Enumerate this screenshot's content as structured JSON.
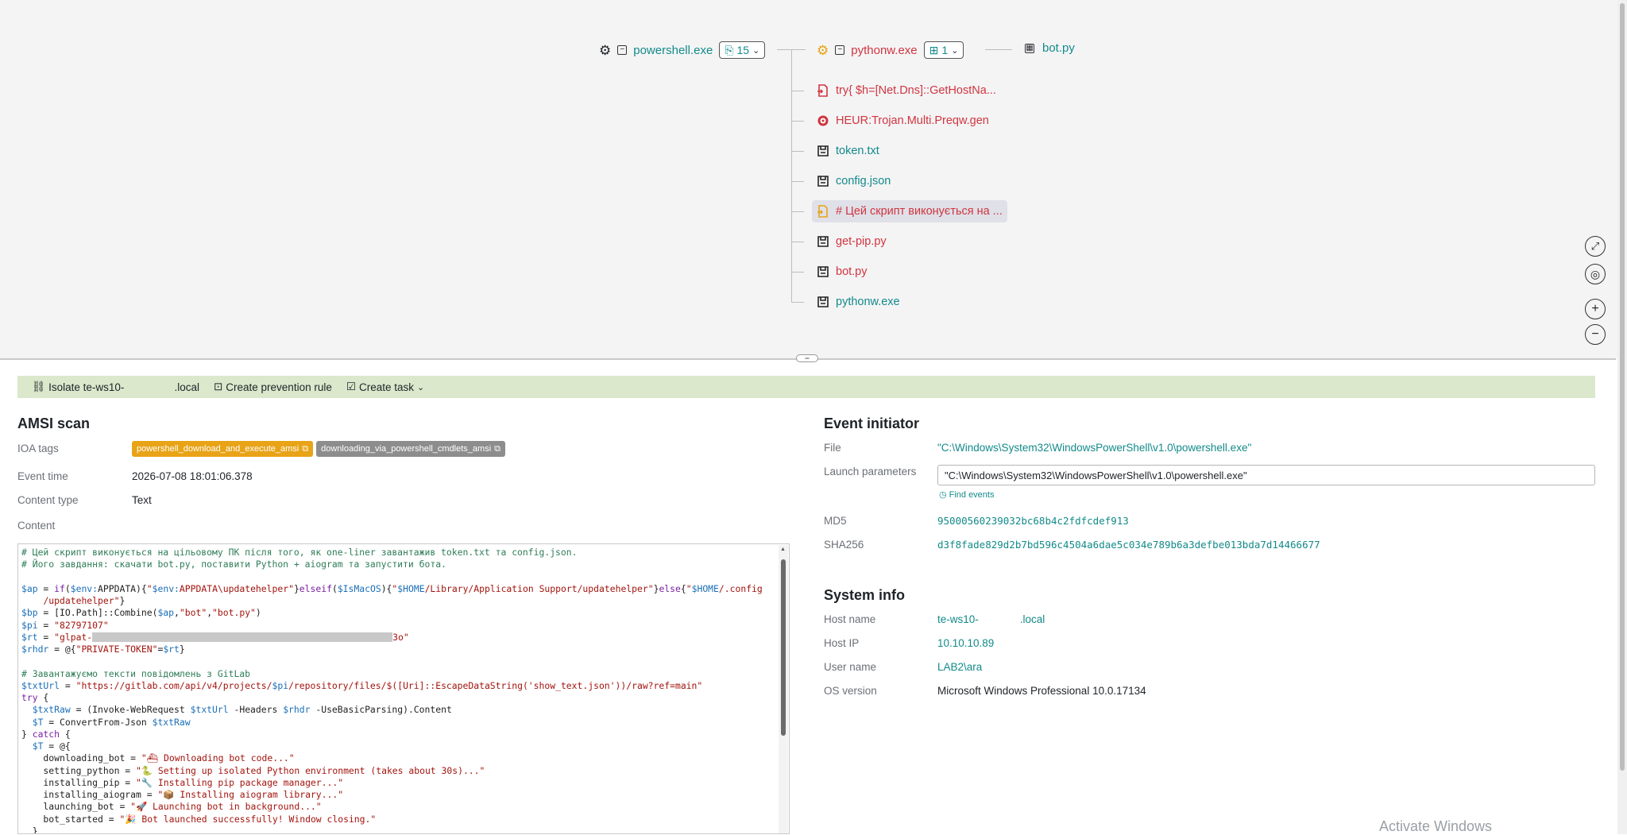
{
  "graph": {
    "root": {
      "label": "powershell.exe",
      "count": "15"
    },
    "child": {
      "label": "pythonw.exe",
      "count": "1"
    },
    "leaf": {
      "label": "bot.py"
    },
    "events": [
      {
        "label": "try{ $h=[Net.Dns]::GetHostNa...",
        "color": "red",
        "icon": "script-exec-icon"
      },
      {
        "label": "HEUR:Trojan.Multi.Preqw.gen",
        "color": "red",
        "icon": "detection-icon"
      },
      {
        "label": "token.txt",
        "color": "teal",
        "icon": "file-write-icon"
      },
      {
        "label": "config.json",
        "color": "teal",
        "icon": "file-write-icon"
      },
      {
        "label": "# Цей скрипт виконується на ...",
        "color": "red",
        "icon": "script-exec-icon"
      },
      {
        "label": "get-pip.py",
        "color": "red",
        "icon": "file-write-icon"
      },
      {
        "label": "bot.py",
        "color": "red",
        "icon": "file-write-icon"
      },
      {
        "label": "pythonw.exe",
        "color": "teal",
        "icon": "file-write-icon"
      }
    ]
  },
  "actions": {
    "isolate_prefix": "Isolate te-ws10-",
    "isolate_suffix": ".local",
    "prevention": "Create prevention rule",
    "task": "Create task"
  },
  "amsi": {
    "title": "AMSI scan",
    "ioa_label": "IOA tags",
    "tags": [
      "powershell_download_and_execute_amsi",
      "downloading_via_powershell_cmdlets_amsi"
    ],
    "event_time_label": "Event time",
    "event_time": "2026-07-08 18:01:06.378",
    "content_type_label": "Content type",
    "content_type": "Text",
    "content_label": "Content"
  },
  "initiator": {
    "title": "Event initiator",
    "file_label": "File",
    "file": "\"C:\\Windows\\System32\\WindowsPowerShell\\v1.0\\powershell.exe\"",
    "launch_label": "Launch parameters",
    "launch": "\"C:\\Windows\\System32\\WindowsPowerShell\\v1.0\\powershell.exe\"",
    "find_events": "Find events",
    "md5_label": "MD5",
    "md5": "95000560239032bc68b4c2fdfcdef913",
    "sha_label": "SHA256",
    "sha": "d3f8fade829d2b7bd596c4504a6dae5c034e789b6a3defbe013bda7d14466677"
  },
  "sysinfo": {
    "title": "System info",
    "host_label": "Host name",
    "host_prefix": "te-ws10-",
    "host_suffix": ".local",
    "ip_label": "Host IP",
    "ip": "10.10.10.89",
    "user_label": "User name",
    "user": "LAB2\\ara",
    "os_label": "OS version",
    "os": "Microsoft Windows Professional 10.0.17134"
  },
  "watermark": "Activate Windows",
  "colors": {
    "teal": "#138a8a",
    "red": "#d0353f",
    "orange": "#e8a317",
    "gray_tag": "#8d8d8d",
    "action_bar": "#dbe8cc"
  }
}
